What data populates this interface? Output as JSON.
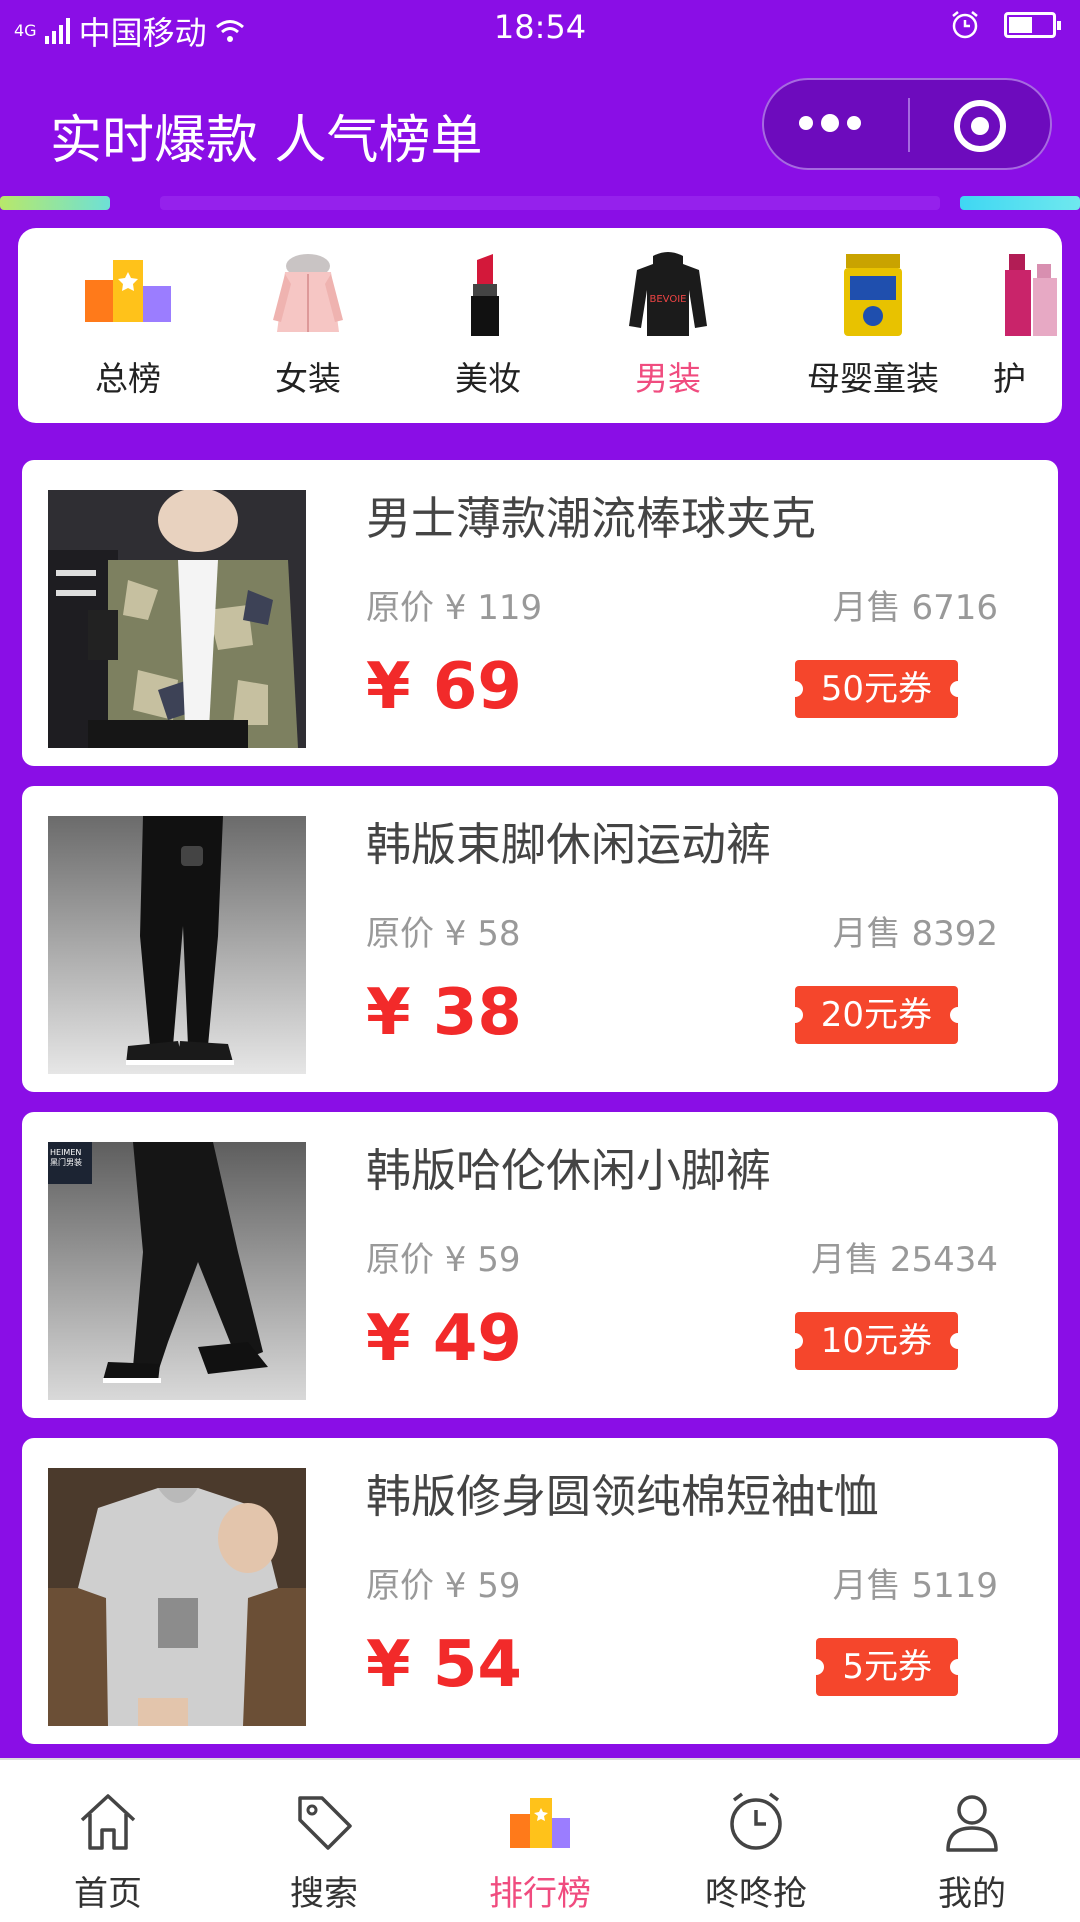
{
  "status_bar": {
    "network": "4G",
    "carrier": "中国移动",
    "time": "18:54",
    "battery_level": 0.55
  },
  "header": {
    "title": "实时爆款 人气榜单"
  },
  "categories": [
    {
      "label": "总榜",
      "icon": "podium-icon",
      "active": false
    },
    {
      "label": "女装",
      "icon": "womens-coat-icon",
      "active": false
    },
    {
      "label": "美妆",
      "icon": "lipstick-icon",
      "active": false
    },
    {
      "label": "男装",
      "icon": "mens-hoodie-icon",
      "active": true
    },
    {
      "label": "母婴童装",
      "icon": "milk-powder-icon",
      "active": false
    },
    {
      "label": "护",
      "icon": "skincare-bottle-icon",
      "active": false
    }
  ],
  "products": [
    {
      "name": "男士薄款潮流棒球夹克",
      "original_price": "原价 ¥ 119",
      "monthly_sales": "月售 6716",
      "price": "¥ 69",
      "coupon": "50元券",
      "image": "camo-jacket-photo"
    },
    {
      "name": "韩版束脚休闲运动裤",
      "original_price": "原价 ¥ 58",
      "monthly_sales": "月售 8392",
      "price": "¥ 38",
      "coupon": "20元券",
      "image": "black-joggers-photo"
    },
    {
      "name": "韩版哈伦休闲小脚裤",
      "original_price": "原价 ¥ 59",
      "monthly_sales": "月售 25434",
      "price": "¥ 49",
      "coupon": "10元券",
      "image": "harem-pants-photo",
      "brand_mark": "HEIMEN\n黑门男装"
    },
    {
      "name": "韩版修身圆领纯棉短袖t恤",
      "original_price": "原价 ¥ 59",
      "monthly_sales": "月售 5119",
      "price": "¥ 54",
      "coupon": "5元券",
      "image": "grey-tshirt-photo"
    }
  ],
  "tabbar": [
    {
      "label": "首页",
      "icon": "home-icon",
      "active": false
    },
    {
      "label": "搜索",
      "icon": "tag-icon",
      "active": false
    },
    {
      "label": "排行榜",
      "icon": "podium-icon",
      "active": true
    },
    {
      "label": "咚咚抢",
      "icon": "alarm-clock-icon",
      "active": false
    },
    {
      "label": "我的",
      "icon": "user-icon",
      "active": false
    }
  ],
  "colors": {
    "brand_purple": "#8a0ee6",
    "accent_pink": "#f04c7f",
    "price_red": "#f22a2a",
    "coupon_orange": "#f5462c"
  }
}
